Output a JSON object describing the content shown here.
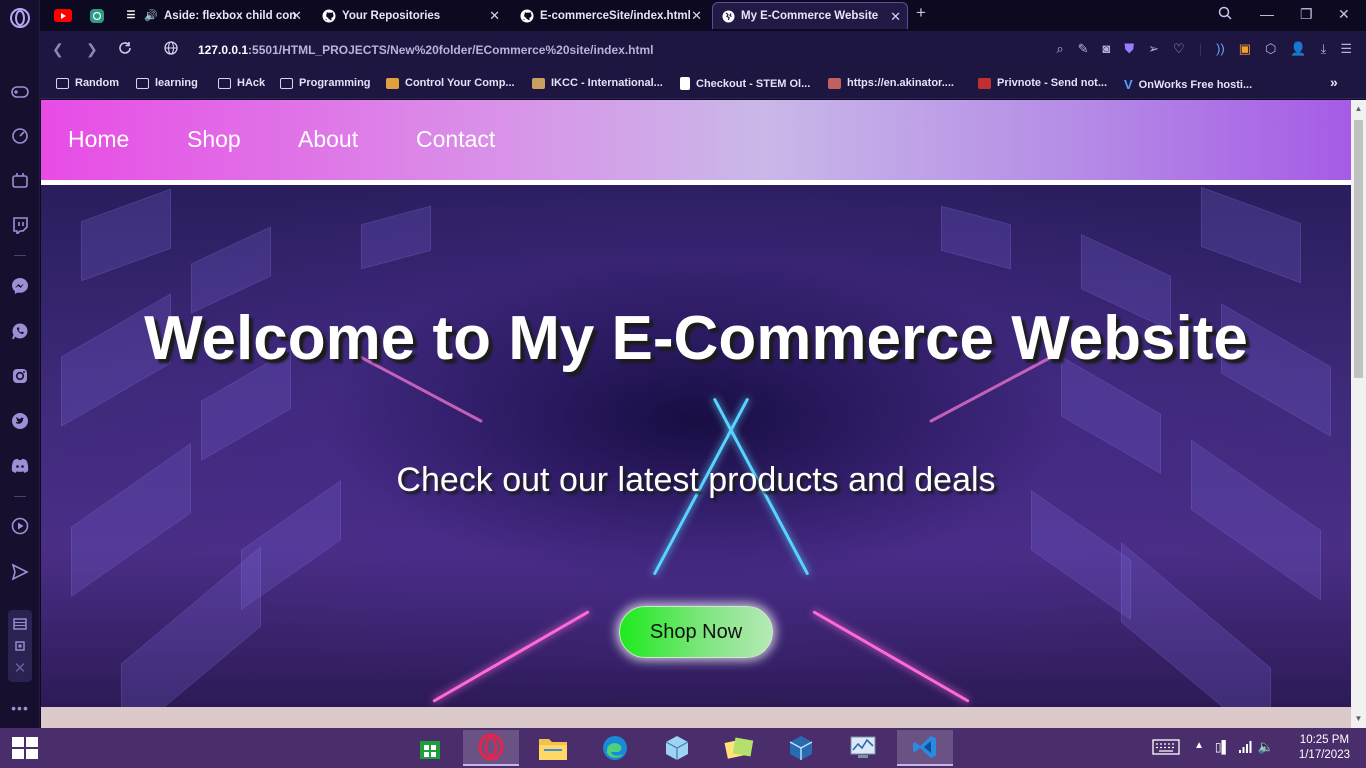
{
  "browser": {
    "tabs": [
      {
        "title": "",
        "icon": "youtube-icon",
        "color": "#ff0000"
      },
      {
        "title": "",
        "icon": "chatgpt-icon",
        "color": "#2f9a86"
      },
      {
        "title": "Aside: flexbox child con",
        "icon": "audio-icon"
      },
      {
        "title": "Your Repositories",
        "icon": "github-icon"
      },
      {
        "title": "E-commerceSite/index.html",
        "icon": "github-icon"
      },
      {
        "title": "My E-Commerce Website",
        "icon": "globe-icon",
        "active": true
      }
    ],
    "url_host": "127.0.0.1",
    "url_path": ":5501/HTML_PROJECTS/New%20folder/ECommerce%20site/index.html",
    "bookmarks": [
      {
        "label": "Random"
      },
      {
        "label": "learning"
      },
      {
        "label": "HAck"
      },
      {
        "label": "Programming"
      },
      {
        "label": "Control Your Comp..."
      },
      {
        "label": "IKCC - International..."
      },
      {
        "label": "Checkout - STEM Ol..."
      },
      {
        "label": "https://en.akinator...."
      },
      {
        "label": "Privnote - Send not..."
      },
      {
        "label": "OnWorks Free hosti..."
      }
    ],
    "more_bookmarks": "»"
  },
  "page": {
    "nav": {
      "home": "Home",
      "shop": "Shop",
      "about": "About",
      "contact": "Contact"
    },
    "hero": {
      "title": "Welcome to My E-Commerce Website",
      "subtitle": "Check out our latest products and deals",
      "button": "Shop Now"
    }
  },
  "taskbar": {
    "time": "10:25 PM",
    "date": "1/17/2023"
  },
  "colors": {
    "nav_gradient_start": "#e84ce6",
    "nav_gradient_end": "#a65be6",
    "button_green": "#1dea1d",
    "taskbar": "#4a2d6b"
  }
}
